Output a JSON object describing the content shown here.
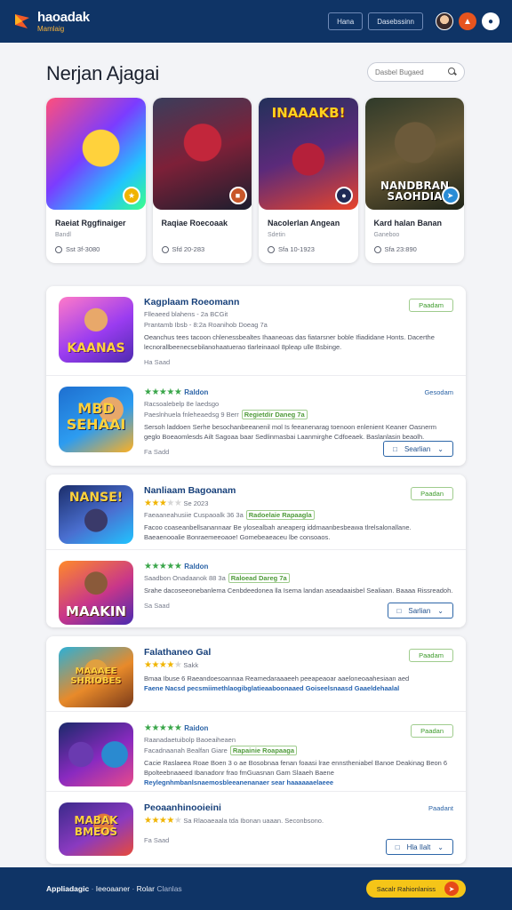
{
  "header": {
    "brand_name": "haoadak",
    "brand_sub": "Mamlaig",
    "nav": [
      "Hana",
      "Dasebssinn"
    ],
    "icons": [
      "avatar",
      "flame-icon",
      "bell-icon"
    ]
  },
  "hero": {
    "title": "Nerjan Ajagai",
    "search_placeholder": "Dasbel Bugaed"
  },
  "featured": [
    {
      "name": "Raeiat Rggfinaiger",
      "sub": "Bandl",
      "meta": "Sst 3f-3080",
      "art_text": ""
    },
    {
      "name": "Raqiae Roecoaak",
      "sub": "",
      "meta": "Sfd 20-283",
      "art_text": ""
    },
    {
      "name": "Nacolerlan Angean",
      "sub": "Sdetin",
      "meta": "Sfa 10-1923",
      "art_text": "INAAAKB!"
    },
    {
      "name": "Kard halan Banan",
      "sub": "Ganeboo",
      "meta": "Sfa 23:890",
      "art_text": "NANDBRAN SAOHDIA"
    }
  ],
  "panels": [
    {
      "button": "Searlian",
      "rows": [
        {
          "title": "Kagplaam Roeomann",
          "meta": "Flleaeed blahens - 2a BCGit",
          "meta2": "Prantamb Ibsb - 8:2a   Roanihob Doeag 7a",
          "tag": "",
          "desc": "Oeanchus tees tacoon chlenessbealtes Ihaaneoas das fiatarsner boble Ifiadidane Honts. Dacerthe lecnorallbeenecsebilanohaatuerao tlarleinaaol 8pleap ulle Bsbinge.",
          "hl": "",
          "foot": "Ha Saad",
          "right": "Paadam",
          "right_type": "pill",
          "stars": "",
          "icon_text": "KAANAS"
        },
        {
          "title": "Raldon",
          "meta": "Racsoalebelp 8e laedsgo",
          "meta2": "Paeslnhuela fnleheaedsg 9 Berr",
          "tag": "Regietdir Daneg 7a",
          "desc": "Sersoh laddoen Serhe besochanbeeanenil mol Is feeanenarag toenoon enlenient Keaner Oasnerm geglo Boeaomlesds Ailt Sagoaa baar Sedlinmasbai Laanmirghe Cdfoeaek. Baslanlasin beaolh.",
          "hl": "",
          "foot": "Fa Sadd",
          "right": "Gesodam",
          "right_type": "plain",
          "stars": "5",
          "icon_text": "MBD SEHAAI"
        }
      ]
    },
    {
      "button": "Sarlian",
      "rows": [
        {
          "title": "Nanliaam Bagoanam",
          "meta": "Se 2023",
          "meta2": "Faeaaneahusiie Cuspaoalk 36 3a",
          "tag": "Radoelaie Rapaagla",
          "desc": "Facoo coaseanbellsanannaar Be ylosealbah aneaperg iddmaanbesbeawa tlrelsalonallane. Baeaenooalie Bonraemeeoaoe! Gomebeaeaceu lbe consoaos.",
          "hl": "",
          "foot": "",
          "right": "Paadan",
          "right_type": "pill",
          "stars": "3",
          "icon_text": "NANSE!"
        },
        {
          "title": "Raldon",
          "meta": "Saadbon Onadaanok 88 3a",
          "meta2": "",
          "tag": "Raloead Dareg 7a",
          "desc": "Srahe dacoseeonebanlema Cenbdeedonea lla Isema landan aseadaaisbel Sealiaan. Baaaa Rissreadoh.",
          "hl": "",
          "foot": "Sa Saad",
          "right": "Paadan",
          "right_type": "pill",
          "stars": "5",
          "icon_text": "MAAKIN"
        }
      ]
    },
    {
      "button": "Hla Ilalt",
      "rows": [
        {
          "title": "Falathaneo Gal",
          "meta": "Sakk",
          "meta2": "",
          "tag": "",
          "desc": "Bmaa Ibuse 6 Raeandoesoannaa Reamedaraaaeeh peeapeaoar aaeloneoaahesiaan aed",
          "hl": "Faene Nacsd pecsmiimethlaogibglatieaaboonaaed Goiseelsnaasd Gaaeldehaalal",
          "foot": "",
          "right": "Paadam",
          "right_type": "pill",
          "stars": "4",
          "icon_text": "MAAAEE SHRIOBES"
        },
        {
          "title": "Raidon",
          "meta": "Raanadaetuibolp Baoeaiheaen",
          "meta2": "Facadnaanah Bealfan Giare",
          "tag": "Rapainie Roapaaga",
          "desc": "Cacie Raslaeea Roae Boen 3 o ae Bosobnaa fenan foaasi lrae ennstheniabel Banoe Deakinag Beon 6 Bpolteebnaaeed Ibanadonr frao fmGuasnan Gam Slaaeh Baene",
          "hl": "Reylegnhmbanlsnaemosbleeanenanaer sear haaaaaaelaeee",
          "foot": "",
          "right": "Paadan",
          "right_type": "pill",
          "stars": "5",
          "icon_text": ""
        },
        {
          "title": "Peoaanhinooieini",
          "meta": "Sa Rlaoaeaala tda Ibonan uaaan. Seconbsono.",
          "meta2": "",
          "tag": "",
          "desc": "",
          "hl": "",
          "foot": "Fa Saad",
          "right": "Paadant",
          "right_type": "plain",
          "stars": "4",
          "icon_text": "MABAK BMEOS"
        }
      ]
    }
  ],
  "footer": {
    "text": "Appliadagic",
    "text2": "Ieeoaaner",
    "text3": "Rolar",
    "text4": "Clanlas",
    "cta": "Sacalr Rahionlaniss"
  },
  "colors": {
    "primary": "#0f3466",
    "accent": "#f5c518",
    "link": "#17407a",
    "green": "#3e9b2c"
  }
}
